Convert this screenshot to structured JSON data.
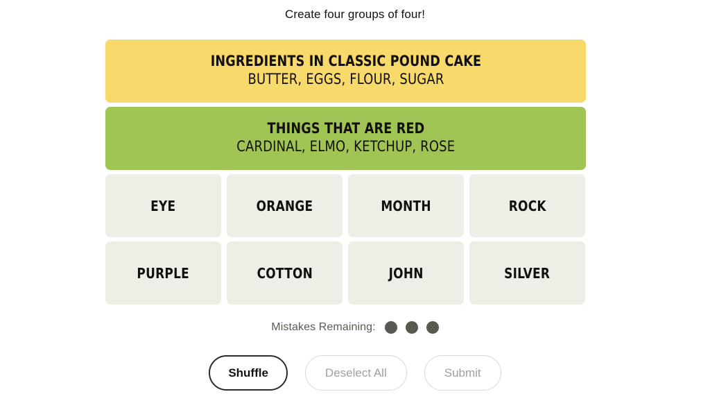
{
  "header": {
    "instruction": "Create four groups of four!"
  },
  "board": {
    "solved_groups": [
      {
        "title": "INGREDIENTS IN CLASSIC POUND CAKE",
        "members": "BUTTER, EGGS, FLOUR, SUGAR",
        "color": "#f7da6b"
      },
      {
        "title": "THINGS THAT ARE RED",
        "members": "CARDINAL, ELMO, KETCHUP, ROSE",
        "color": "#a1c554"
      }
    ],
    "tiles": [
      {
        "label": "EYE"
      },
      {
        "label": "ORANGE"
      },
      {
        "label": "MONTH"
      },
      {
        "label": "ROCK"
      },
      {
        "label": "PURPLE"
      },
      {
        "label": "COTTON"
      },
      {
        "label": "JOHN"
      },
      {
        "label": "SILVER"
      }
    ],
    "tile_color": "#eeeee6"
  },
  "mistakes": {
    "label": "Mistakes Remaining:",
    "remaining": 3,
    "dot_color": "#5a594f"
  },
  "actions": {
    "shuffle_label": "Shuffle",
    "deselect_label": "Deselect All",
    "submit_label": "Submit"
  }
}
